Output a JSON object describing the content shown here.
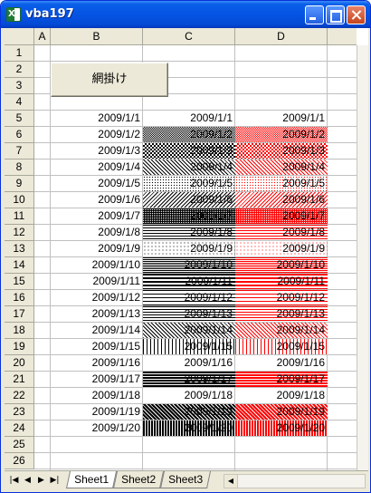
{
  "window": {
    "title": "vba197"
  },
  "columns": [
    "A",
    "B",
    "C",
    "D"
  ],
  "rows": [
    "1",
    "2",
    "3",
    "4",
    "5",
    "6",
    "7",
    "8",
    "9",
    "10",
    "11",
    "12",
    "13",
    "14",
    "15",
    "16",
    "17",
    "18",
    "19",
    "20",
    "21",
    "22",
    "23",
    "24",
    "25",
    "26"
  ],
  "macro_button": {
    "label": "網掛け"
  },
  "dates": [
    "2009/1/1",
    "2009/1/2",
    "2009/1/3",
    "2009/1/4",
    "2009/1/5",
    "2009/1/6",
    "2009/1/7",
    "2009/1/8",
    "2009/1/9",
    "2009/1/10",
    "2009/1/11",
    "2009/1/12",
    "2009/1/13",
    "2009/1/14",
    "2009/1/15",
    "2009/1/16",
    "2009/1/17",
    "2009/1/18",
    "2009/1/19",
    "2009/1/20"
  ],
  "pattern_colors": {
    "C": "#000000",
    "D": "#ff0000"
  },
  "sheet_tabs": [
    "Sheet1",
    "Sheet2",
    "Sheet3"
  ],
  "active_tab": "Sheet1",
  "nav_icons": [
    "first-sheet-icon",
    "prev-sheet-icon",
    "next-sheet-icon",
    "last-sheet-icon"
  ]
}
